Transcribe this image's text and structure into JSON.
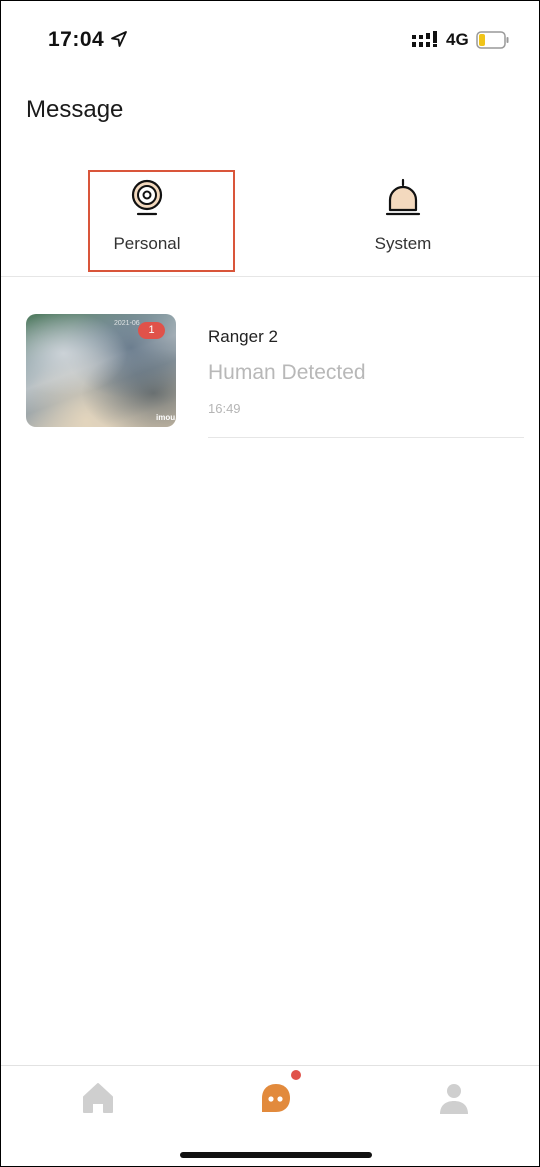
{
  "status_bar": {
    "time": "17:04",
    "network": "4G",
    "icons": [
      "location-arrow-icon",
      "signal-icon",
      "battery-icon"
    ],
    "battery_color": "#f0c419"
  },
  "header": {
    "title": "Message"
  },
  "tabs": [
    {
      "label": "Personal",
      "icon": "camera-icon",
      "selected": true
    },
    {
      "label": "System",
      "icon": "bell-icon",
      "selected": false
    }
  ],
  "messages": [
    {
      "device": "Ranger 2",
      "event": "Human Detected",
      "time": "16:49",
      "badge_count": "1",
      "thumbnail_timestamp": "2021-06",
      "thumbnail_brand": "imou"
    }
  ],
  "bottom_nav": {
    "items": [
      {
        "name": "home",
        "icon": "home-icon"
      },
      {
        "name": "messages",
        "icon": "chat-bubble-icon",
        "active": true,
        "has_notification_dot": true
      },
      {
        "name": "profile",
        "icon": "user-icon"
      }
    ]
  },
  "colors": {
    "accent": "#e28a3c",
    "highlight_border": "#d9553a",
    "badge": "#e0524a",
    "muted_text": "#b8b8b8",
    "inactive_icon": "#cfcfcf"
  }
}
